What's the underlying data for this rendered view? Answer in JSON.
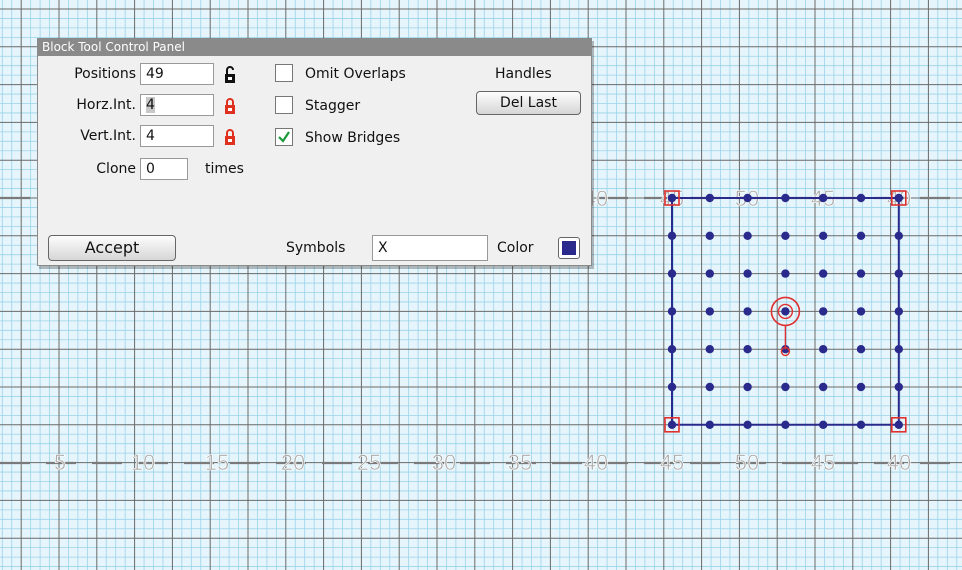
{
  "panel": {
    "title": "Block Tool Control Panel",
    "positions": {
      "label": "Positions",
      "value": "49",
      "lock": "unlocked"
    },
    "horz_int": {
      "label": "Horz.Int.",
      "value": "4",
      "lock": "locked"
    },
    "vert_int": {
      "label": "Vert.Int.",
      "value": "4",
      "lock": "locked"
    },
    "clone": {
      "label": "Clone",
      "value": "0",
      "suffix": "times"
    },
    "omit_overlaps": {
      "label": "Omit Overlaps",
      "checked": false
    },
    "stagger": {
      "label": "Stagger",
      "checked": false
    },
    "show_bridges": {
      "label": "Show Bridges",
      "checked": true
    },
    "handles_label": "Handles",
    "del_last_button": "Del Last",
    "accept_button": "Accept",
    "symbols": {
      "label": "Symbols",
      "value": "X"
    },
    "color": {
      "label": "Color",
      "value": "#2a2a8c"
    }
  },
  "field": {
    "yard_numbers": [
      "5",
      "10",
      "15",
      "20",
      "25",
      "30",
      "35",
      "40",
      "45",
      "50",
      "45",
      "40"
    ],
    "background_color": "#e6f5fb",
    "grid_color": "#9ad3ea",
    "line_color": "#6a6a6a"
  },
  "block": {
    "rows": 7,
    "cols": 7,
    "dot_color": "#2a2a8c",
    "handle_color": "#e03030"
  }
}
